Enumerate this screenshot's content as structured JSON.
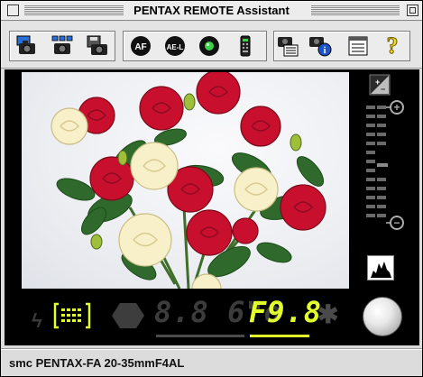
{
  "window": {
    "title": "PENTAX REMOTE Assistant"
  },
  "toolbar": {
    "groups": [
      {
        "id": "capture",
        "buttons": [
          {
            "name": "capture-preview-icon"
          },
          {
            "name": "multi-capture-icon"
          },
          {
            "name": "capture-save-icon"
          }
        ]
      },
      {
        "id": "camera-controls",
        "buttons": [
          {
            "name": "af-button",
            "label": "AF"
          },
          {
            "name": "ae-lock-button",
            "label": "AE-L"
          },
          {
            "name": "status-led-button"
          },
          {
            "name": "remote-control-icon"
          }
        ]
      },
      {
        "id": "info",
        "buttons": [
          {
            "name": "camera-settings-icon"
          },
          {
            "name": "camera-info-icon"
          },
          {
            "name": "list-view-icon"
          },
          {
            "name": "help-icon",
            "label": "?"
          }
        ]
      }
    ]
  },
  "exposure": {
    "plus_label": "+",
    "minus_label": "−"
  },
  "lcd": {
    "flash_symbol": "ϟ",
    "shutter": "8.8 6\"o",
    "aperture": "F9.8",
    "star_symbol": "✱"
  },
  "status": {
    "lens": "smc PENTAX-FA 20-35mmF4AL"
  },
  "colors": {
    "lcd_active": "#e3ff2a",
    "lcd_inactive": "#3c3c3c"
  }
}
